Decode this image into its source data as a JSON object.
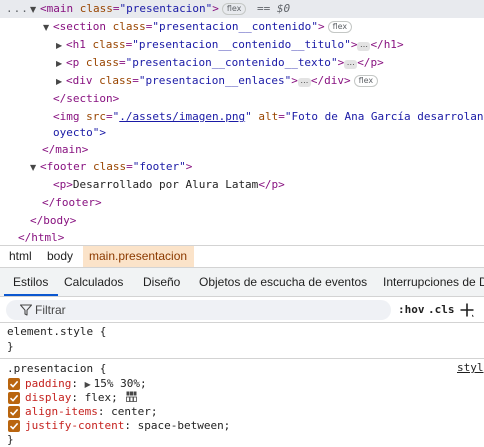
{
  "elements_tree": {
    "overflow_dots": "...",
    "selected_suffix": "== $0",
    "badges": {
      "flex": "flex",
      "ellipsis": "…"
    },
    "main_open": "<main class=\"presentacion\">",
    "main_tag": "main",
    "main_attr": "class",
    "main_value": "presentacion",
    "section_tag": "section",
    "section_attr": "class",
    "section_value": "presentacion__contenido",
    "h1_tag": "h1",
    "h1_attr": "class",
    "h1_value": "presentacion__contenido__titulo",
    "p_tag": "p",
    "p_attr": "class",
    "p_value": "presentacion__contenido__texto",
    "div_tag": "div",
    "div_attr": "class",
    "div_value": "presentacion__enlaces",
    "section_close": "</section>",
    "img_tag": "img",
    "img_src_attr": "src",
    "img_src_value": "./assets/imagen.png",
    "img_alt_attr": "alt",
    "img_alt_value": "Foto de Ana García desarrolando proyecto",
    "img_alt_line1": "\"Foto de Ana García desarrolando pr",
    "img_alt_line2": "oyecto\">",
    "main_close": "</main>",
    "footer_tag": "footer",
    "footer_attr": "class",
    "footer_value": "footer",
    "footer_p_text": "Desarrollado por Alura Latam",
    "footer_close": "</footer>",
    "body_close": "</body>",
    "html_close": "</html>"
  },
  "breadcrumb": [
    "html",
    "body",
    "main.presentacion"
  ],
  "tabs": [
    "Estilos",
    "Calculados",
    "Diseño",
    "Objetos de escucha de eventos",
    "Interrupciones de D"
  ],
  "filter": {
    "placeholder": "Filtrar",
    "hov": ":hov",
    "cls": ".cls"
  },
  "styles": {
    "element_style_selector": "element.style {",
    "element_style_close": "}",
    "rule_selector": ".presentacion {",
    "source": "styl",
    "declarations": [
      {
        "property": "padding",
        "value": "15% 30%;",
        "has_expander": true
      },
      {
        "property": "display",
        "value": "flex;",
        "has_grid_icon": true
      },
      {
        "property": "align-items",
        "value": "center;"
      },
      {
        "property": "justify-content",
        "value": "space-between;"
      }
    ],
    "rule_close": "}"
  },
  "colors": {
    "tag": "#881280",
    "attr_name": "#994500",
    "attr_value": "#1a1aa6",
    "selected_breadcrumb_bg": "#fbe3c9",
    "active_tab_underline": "#0b57d0",
    "checkbox": "#b9650f",
    "css_property": "#c5221f"
  }
}
